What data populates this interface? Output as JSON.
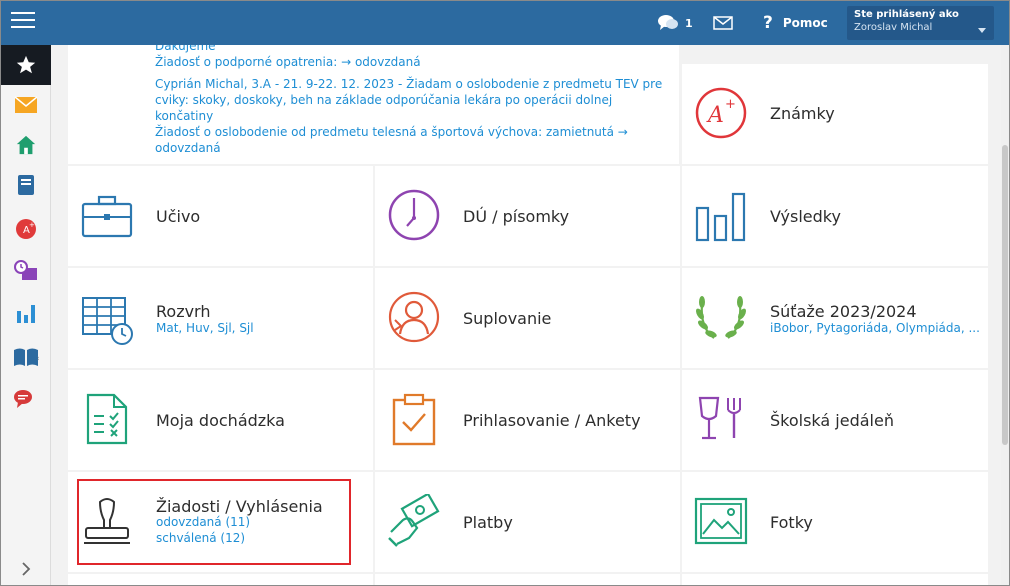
{
  "header": {
    "chat_count": "1",
    "help_label": "Pomoc",
    "user_label": "Ste prihlásený ako",
    "user_name": "Zoroslav Michal",
    "bg_color": "#2c6aa0"
  },
  "sidebar": {
    "items": [
      {
        "name": "favorites",
        "icon": "star-icon"
      },
      {
        "name": "messages",
        "icon": "envelope-icon"
      },
      {
        "name": "home",
        "icon": "home-icon"
      },
      {
        "name": "notebook",
        "icon": "notebook-icon"
      },
      {
        "name": "grades",
        "icon": "grade-icon"
      },
      {
        "name": "homework",
        "icon": "clock-desk-icon"
      },
      {
        "name": "results",
        "icon": "bar-chart-icon"
      },
      {
        "name": "books",
        "icon": "book-icon"
      },
      {
        "name": "chat",
        "icon": "chat-icon"
      }
    ]
  },
  "news": {
    "lines": [
      "Ďakujeme",
      "Žiadosť o podporné opatrenia: → odovzdaná",
      "Cyprián Michal, 3.A - 21. 9-22. 12. 2023 - Žiadam o oslobodenie z predmetu TEV pre",
      "cviky: skoky, doskoky, beh na základe odporúčania lekára po operácii dolnej",
      "končatiny",
      "Žiadosť o oslobodenie od predmetu telesná a športová výchova: zamietnutá →",
      "odovzdaná"
    ]
  },
  "tiles": {
    "znamky": {
      "title": "Známky"
    },
    "ucivo": {
      "title": "Učivo"
    },
    "du": {
      "title": "DÚ / písomky"
    },
    "vysledky": {
      "title": "Výsledky"
    },
    "rozvrh": {
      "title": "Rozvrh",
      "sub": "Mat, Huv, Sjl, Sjl"
    },
    "suplovanie": {
      "title": "Suplovanie"
    },
    "sutaze": {
      "title": "Súťaže 2023/2024",
      "sub": "iBobor, Pytagoriáda, Olympiáda, ..."
    },
    "dochadzka": {
      "title": "Moja dochádzka"
    },
    "ankety": {
      "title": "Prihlasovanie / Ankety"
    },
    "jedalen": {
      "title": "Školská jedáleň"
    },
    "ziadosti": {
      "title": "Žiadosti / Vyhlásenia",
      "sub1": "odovzdaná (11)",
      "sub2": "schválená (12)"
    },
    "platby": {
      "title": "Platby"
    },
    "fotky": {
      "title": "Fotky"
    }
  }
}
